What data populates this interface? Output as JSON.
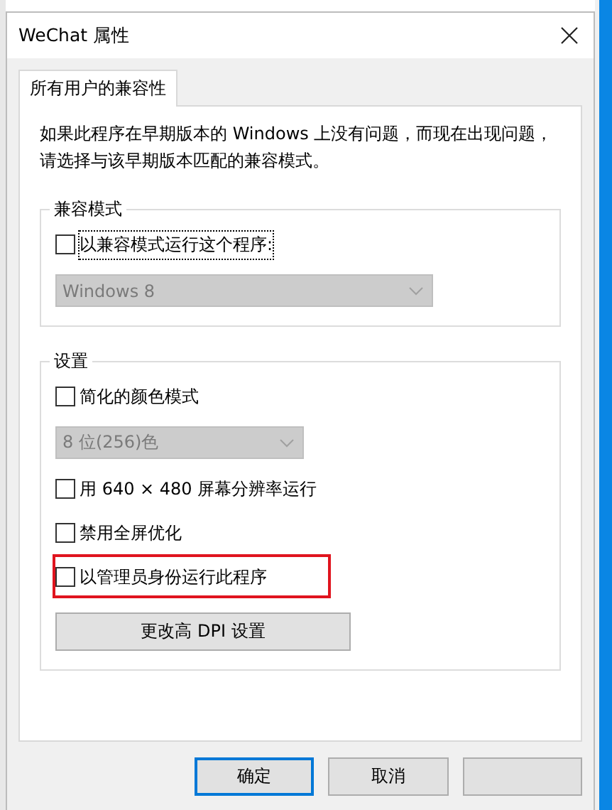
{
  "window": {
    "title": "WeChat 属性"
  },
  "tabs": [
    {
      "label": "所有用户的兼容性",
      "selected": true
    }
  ],
  "description": [
    "如果此程序在早期版本的 Windows 上没有问题，而现在出现问题，",
    "请选择与该早期版本匹配的兼容模式。"
  ],
  "groups": [
    {
      "title": "兼容模式",
      "items": [
        {
          "kind": "checkbox",
          "label": "以兼容模式运行这个程序:",
          "checked": false,
          "focused": true
        },
        {
          "kind": "dropdown",
          "value": "Windows 8",
          "disabled": true
        }
      ]
    },
    {
      "title": "设置",
      "items": [
        {
          "kind": "checkbox",
          "label": "简化的颜色模式",
          "checked": false
        },
        {
          "kind": "dropdown",
          "value": "8 位(256)色",
          "disabled": true
        },
        {
          "kind": "checkbox",
          "label": "用 640 × 480 屏幕分辨率运行",
          "checked": false
        },
        {
          "kind": "checkbox",
          "label": "禁用全屏优化",
          "checked": false
        },
        {
          "kind": "checkbox",
          "label": "以管理员身份运行此程序",
          "checked": false,
          "highlighted": true
        },
        {
          "kind": "button",
          "label": "更改高 DPI 设置"
        }
      ]
    }
  ],
  "buttons": [
    {
      "label": "确定",
      "default": true
    },
    {
      "label": "取消",
      "default": false
    },
    {
      "default": false
    }
  ]
}
